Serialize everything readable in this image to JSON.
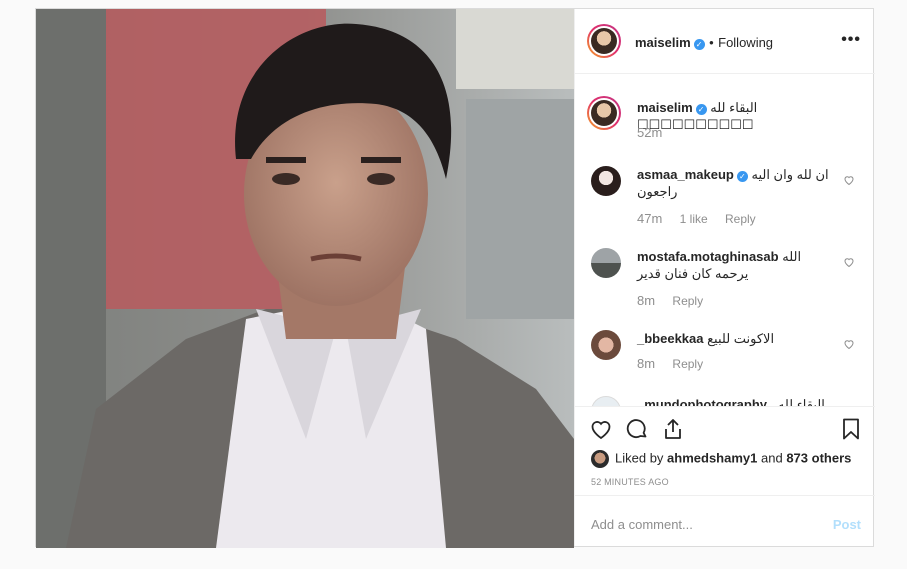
{
  "header": {
    "username": "maiselim",
    "separator": "•",
    "follow_status": "Following",
    "more_label": "•••"
  },
  "caption": {
    "username": "maiselim",
    "text": "البقاء لله ☐☐☐☐☐☐☐☐☐☐",
    "time": "52m"
  },
  "comments": [
    {
      "username": "asmaa_makeup",
      "verified": true,
      "text": "ان لله وان اليه راجعون",
      "time": "47m",
      "likes": "1 like",
      "reply": "Reply"
    },
    {
      "username": "mostafa.motaghinasab",
      "verified": false,
      "text": "الله يرحمه كان فنان قدير",
      "time": "8m",
      "likes": "",
      "reply": "Reply"
    },
    {
      "username": "_bbeekkaa",
      "verified": false,
      "text": "الاكونت للبيع",
      "time": "8m",
      "likes": "",
      "reply": "Reply"
    },
    {
      "username": "_mundophotography_",
      "verified": false,
      "text": "البقاء لله",
      "time": "",
      "likes": "",
      "reply": ""
    }
  ],
  "likes": {
    "prefix": "Liked by",
    "user": "ahmedshamy1",
    "conj": "and",
    "others": "873 others"
  },
  "timestamp": "52 MINUTES AGO",
  "add_comment": {
    "placeholder": "Add a comment...",
    "post_label": "Post"
  },
  "colors": {
    "accent": "#3897f0",
    "post_disabled": "#b2dffc",
    "secondary_text": "#8e8e8e"
  }
}
